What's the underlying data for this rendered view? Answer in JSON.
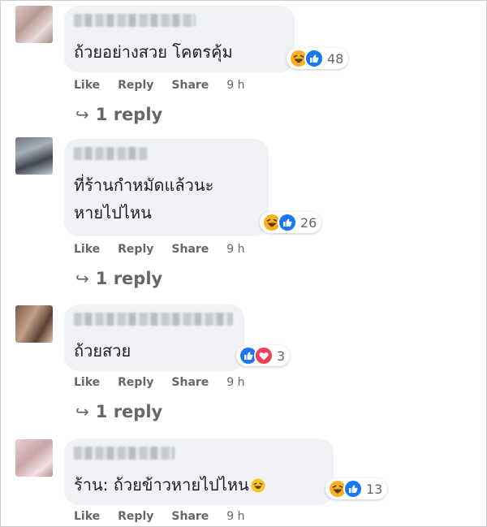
{
  "comments": [
    {
      "text_lines": [
        "ถ้วยอย่างสวย โคตรคุ้ม"
      ],
      "reaction_count": "48",
      "reactions": [
        "haha-icon",
        "like-icon"
      ],
      "actions": {
        "like": "Like",
        "reply": "Reply",
        "share": "Share",
        "time": "9 h"
      },
      "replies_label": "1 reply"
    },
    {
      "text_lines": [
        "ที่ร้านกำหมัดแล้วนะ",
        "หายไปไหน"
      ],
      "reaction_count": "26",
      "reactions": [
        "haha-icon",
        "like-icon"
      ],
      "actions": {
        "like": "Like",
        "reply": "Reply",
        "share": "Share",
        "time": "9 h"
      },
      "replies_label": "1 reply"
    },
    {
      "text_lines": [
        "ถ้วยสวย"
      ],
      "reaction_count": "3",
      "reactions": [
        "like-icon",
        "love-icon"
      ],
      "actions": {
        "like": "Like",
        "reply": "Reply",
        "share": "Share",
        "time": "9 h"
      },
      "replies_label": "1 reply"
    },
    {
      "text_lines": [
        "ร้าน: ถ้วยข้าวหายไปไหน"
      ],
      "reaction_count": "13",
      "reactions": [
        "haha-icon",
        "like-icon"
      ],
      "actions": {
        "like": "Like",
        "reply": "Reply",
        "share": "Share",
        "time": "9 h"
      }
    }
  ],
  "colors": {
    "bubble": "#f0f2f5",
    "meta_text": "#65676b",
    "like_blue": "#1877f2",
    "love_red": "#f33e58",
    "haha_yellow": "#f7b125"
  }
}
